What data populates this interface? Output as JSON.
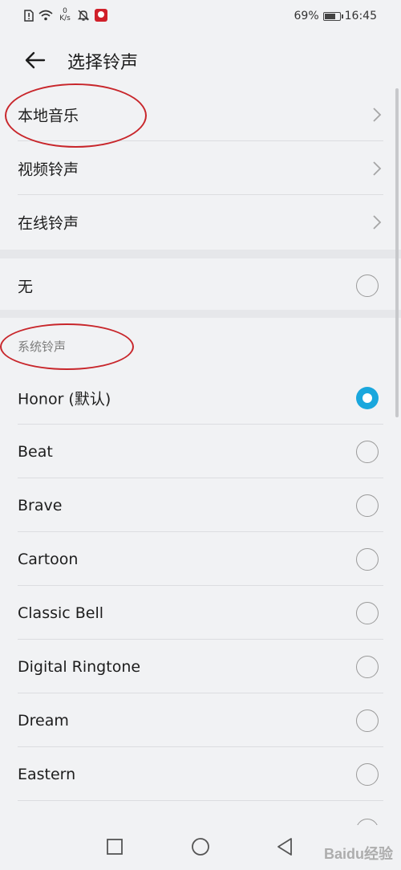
{
  "status_bar": {
    "netspeed_value": "0",
    "netspeed_unit": "K/s",
    "battery": "69%",
    "time": "16:45"
  },
  "header": {
    "title": "选择铃声"
  },
  "sources": [
    {
      "label": "本地音乐",
      "icon": "chevron-right-icon"
    },
    {
      "label": "视频铃声",
      "icon": "chevron-right-icon"
    },
    {
      "label": "在线铃声",
      "icon": "chevron-right-icon"
    }
  ],
  "none_option": {
    "label": "无",
    "selected": false
  },
  "system_section": {
    "header": "系统铃声",
    "ringtones": [
      {
        "label": "Honor (默认)",
        "selected": true
      },
      {
        "label": "Beat",
        "selected": false
      },
      {
        "label": "Brave",
        "selected": false
      },
      {
        "label": "Cartoon",
        "selected": false
      },
      {
        "label": "Classic Bell",
        "selected": false
      },
      {
        "label": "Digital Ringtone",
        "selected": false
      },
      {
        "label": "Dream",
        "selected": false
      },
      {
        "label": "Eastern",
        "selected": false
      }
    ]
  },
  "nav_bar": {
    "icons": [
      "recent-apps-icon",
      "home-icon",
      "back-icon"
    ]
  },
  "watermark": "Baidu经验",
  "colors": {
    "accent": "#1aa7dd",
    "annotation": "#c8262b",
    "background": "#f1f2f4"
  }
}
